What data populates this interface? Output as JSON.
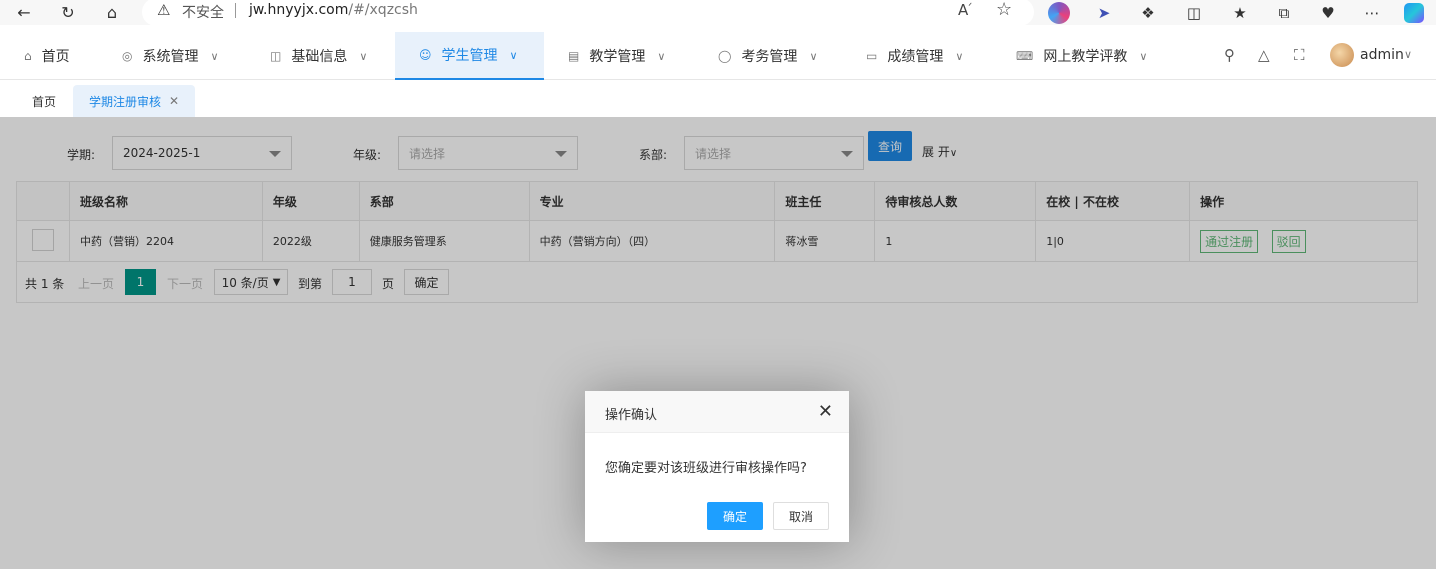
{
  "browser": {
    "insecure_label": "不安全",
    "url_host": "jw.hnyyjx.com",
    "url_path": "/#/xqzcsh",
    "read_aloud": "A"
  },
  "nav": {
    "items": [
      {
        "label": "首页",
        "icon": "home-icon"
      },
      {
        "label": "系统管理",
        "icon": "settings-icon"
      },
      {
        "label": "基础信息",
        "icon": "layout-icon"
      },
      {
        "label": "学生管理",
        "icon": "user-icon"
      },
      {
        "label": "教学管理",
        "icon": "template-icon"
      },
      {
        "label": "考务管理",
        "icon": "circle-icon"
      },
      {
        "label": "成绩管理",
        "icon": "monitor-icon"
      },
      {
        "label": "网上教学评教",
        "icon": "code-icon"
      }
    ],
    "active_index": 3,
    "user": "admin"
  },
  "tabs": [
    {
      "label": "首页"
    },
    {
      "label": "学期注册审核"
    }
  ],
  "filter": {
    "term_label": "学期:",
    "term_value": "2024-2025-1",
    "grade_label": "年级:",
    "grade_placeholder": "请选择",
    "dept_label": "系部:",
    "dept_placeholder": "请选择",
    "query_button": "查询",
    "expand_label": "展 开"
  },
  "table": {
    "columns": [
      "",
      "班级名称",
      "年级",
      "系部",
      "专业",
      "班主任",
      "待审核总人数",
      "在校 | 不在校",
      "操作"
    ],
    "rows": [
      {
        "class_name": "中药（营销）2204",
        "grade": "2022级",
        "dept": "健康服务管理系",
        "major": "中药（营销方向）（四）",
        "teacher": "蒋冰雪",
        "pending": "1",
        "in_school": "1",
        "not_in_school": "0",
        "sep": "|",
        "approve_label": "通过注册",
        "reject_label": "驳回"
      }
    ]
  },
  "pager": {
    "total": "共 1 条",
    "prev": "上一页",
    "current": "1",
    "next": "下一页",
    "page_size": "10 条/页",
    "goto_label": "到第",
    "goto_value": "1",
    "page_unit": "页",
    "confirm": "确定"
  },
  "dialog": {
    "title": "操作确认",
    "message": "您确定要对该班级进行审核操作吗?",
    "ok": "确定",
    "cancel": "取消"
  },
  "colors": {
    "accent": "#1e88e5",
    "pager_active": "#009688",
    "ok_button": "#1e9fff",
    "approve_green": "#5fb878",
    "in_school_red": "#e53935"
  }
}
